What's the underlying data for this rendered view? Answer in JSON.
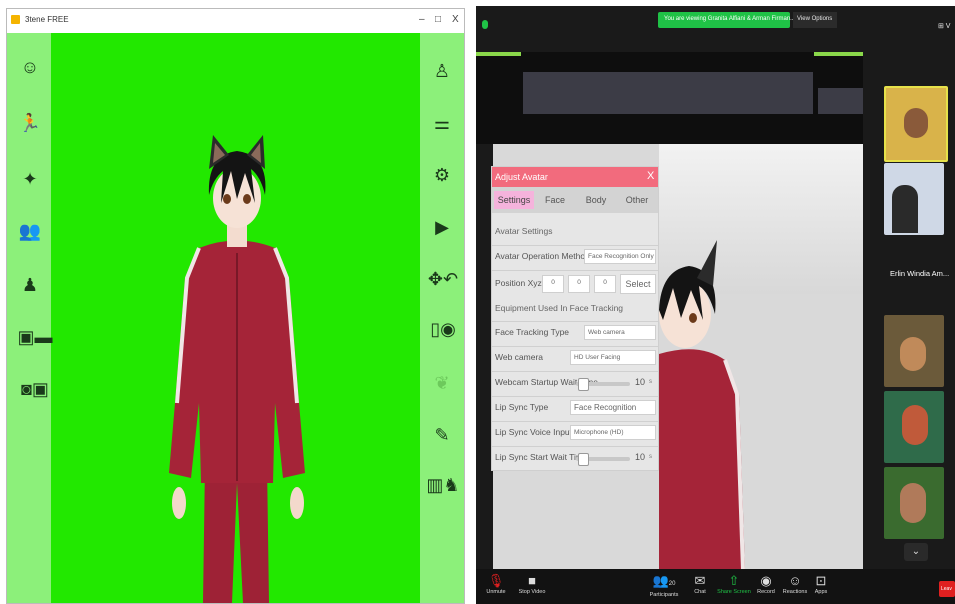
{
  "left_window": {
    "title": "3tene FREE",
    "controls": {
      "minimize": "–",
      "maximize": "□",
      "close": "X"
    },
    "colors": {
      "stage": "#22e800",
      "sidebar": "#8cf07a"
    },
    "left_sidebar_icons": [
      "face-icon",
      "pose-icon",
      "magic-wand-icon",
      "people-icon",
      "avatar-stand-icon",
      "image-couch-icon",
      "camera-video-icon"
    ],
    "right_sidebar_icons": [
      "person-icon",
      "sliders-icon",
      "gear-icon",
      "video-camera-icon",
      "move-rotate-icon",
      "capture-icon",
      "leaf-icon",
      "notepad-icon",
      "book-icon"
    ]
  },
  "zoom": {
    "banner": "You are viewing Granita Alfiani & Arman Firman...'s screen",
    "view_options": "View Options",
    "top_right": "⊞ V",
    "participant_name": "Erlin Windia Am...",
    "leave_label": "Leav",
    "bottom_bar": {
      "unmute": "Unmute",
      "stop_video": "Stop Video",
      "participants": "Participants",
      "participants_count": "20",
      "chat": "Chat",
      "share_screen": "Share Screen",
      "record": "Record",
      "reactions": "Reactions",
      "apps": "Apps"
    },
    "colors": {
      "banner": "#1fc246",
      "leave": "#e02020"
    }
  },
  "adjust_avatar": {
    "title": "Adjust Avatar",
    "close": "X",
    "tabs": [
      "Settings",
      "Face",
      "Body",
      "Other"
    ],
    "section_avatar": "Avatar Settings",
    "avatar_operation_method_label": "Avatar Operation Method",
    "avatar_operation_method_value": "Face Recognition Only",
    "position_label": "Position Xyz",
    "position_values": [
      "0",
      "0",
      "0"
    ],
    "select_label": "Select",
    "section_equipment": "Equipment Used In Face Tracking",
    "face_tracking_type_label": "Face Tracking Type",
    "face_tracking_type_value": "Web camera",
    "web_camera_label": "Web camera",
    "web_camera_value": "HD User Facing",
    "webcam_wait_label": "Webcam Startup Wait Time",
    "webcam_wait_value": "10",
    "webcam_wait_unit": "s",
    "lip_sync_type_label": "Lip Sync Type",
    "lip_sync_type_value": "Face Recognition",
    "lip_sync_voice_label": "Lip Sync Voice Input",
    "lip_sync_voice_value": "Microphone (HD)",
    "lip_sync_start_label": "Lip Sync Start Wait Time",
    "lip_sync_start_value": "10",
    "lip_sync_start_unit": "s",
    "header_color": "#f26b7d"
  }
}
